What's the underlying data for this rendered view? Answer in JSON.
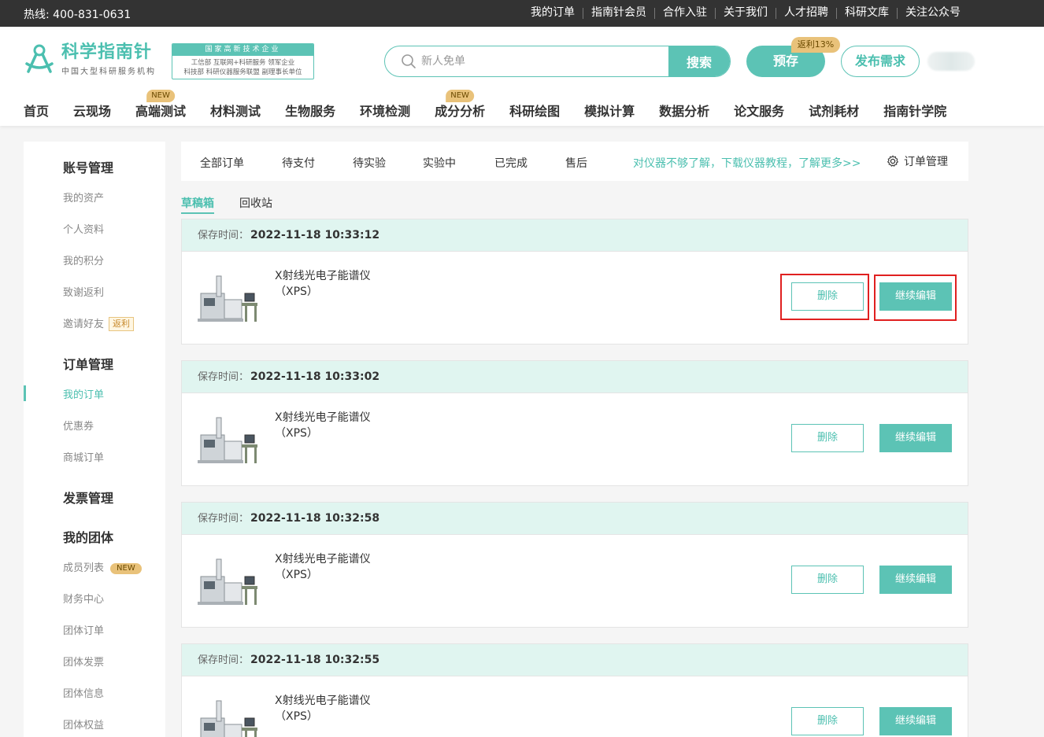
{
  "topbar": {
    "hotline": "热线: 400-831-0631",
    "links": [
      "我的订单",
      "指南针会员",
      "合作入驻",
      "关于我们",
      "人才招聘",
      "科研文库",
      "关注公众号"
    ]
  },
  "logo": {
    "main": "科学指南针",
    "sub": "中国大型科研服务机构"
  },
  "badge": {
    "title": "国家高新技术企业",
    "line1": "工信部 互联网+科研服务 领军企业",
    "line2": "科技部 科研仪器服务联盟 副理事长单位"
  },
  "search": {
    "placeholder": "新人免单",
    "button": "搜索"
  },
  "actions": {
    "preorder": "预存",
    "rebate": "返利13%",
    "publish": "发布需求"
  },
  "nav": [
    {
      "label": "首页"
    },
    {
      "label": "云现场"
    },
    {
      "label": "高端测试",
      "tag": "NEW"
    },
    {
      "label": "材料测试"
    },
    {
      "label": "生物服务"
    },
    {
      "label": "环境检测"
    },
    {
      "label": "成分分析",
      "tag": "NEW"
    },
    {
      "label": "科研绘图"
    },
    {
      "label": "模拟计算"
    },
    {
      "label": "数据分析"
    },
    {
      "label": "论文服务"
    },
    {
      "label": "试剂耗材"
    },
    {
      "label": "指南针学院"
    }
  ],
  "sidebar": {
    "account": {
      "title": "账号管理",
      "items": [
        "我的资产",
        "个人资料",
        "我的积分",
        "致谢返利",
        "邀请好友"
      ],
      "invite_tag": "返利"
    },
    "orders": {
      "title": "订单管理",
      "items": [
        "我的订单",
        "优惠券",
        "商城订单"
      ]
    },
    "invoice": {
      "title": "发票管理"
    },
    "team": {
      "title": "我的团体",
      "items": [
        "成员列表",
        "财务中心",
        "团体订单",
        "团体发票",
        "团体信息",
        "团体权益"
      ],
      "member_tag": "NEW"
    }
  },
  "tabs": [
    "全部订单",
    "待支付",
    "待实验",
    "实验中",
    "已完成",
    "售后"
  ],
  "tip": "对仪器不够了解，下载仪器教程，了解更多>>",
  "manage": "订单管理",
  "subtabs": [
    "草稿箱",
    "回收站"
  ],
  "save_label": "保存时间：",
  "delete_label": "删除",
  "edit_label": "继续编辑",
  "drafts": [
    {
      "time": "2022-11-18 10:33:12",
      "name": "X射线光电子能谱仪",
      "code": "（XPS）"
    },
    {
      "time": "2022-11-18 10:33:02",
      "name": "X射线光电子能谱仪",
      "code": "（XPS）"
    },
    {
      "time": "2022-11-18 10:32:58",
      "name": "X射线光电子能谱仪",
      "code": "（XPS）"
    },
    {
      "time": "2022-11-18 10:32:55",
      "name": "X射线光电子能谱仪",
      "code": "（XPS）"
    }
  ],
  "colors": {
    "accent": "#5cc3b5",
    "highlight": "#e02020",
    "gold": "#e9c27a"
  }
}
